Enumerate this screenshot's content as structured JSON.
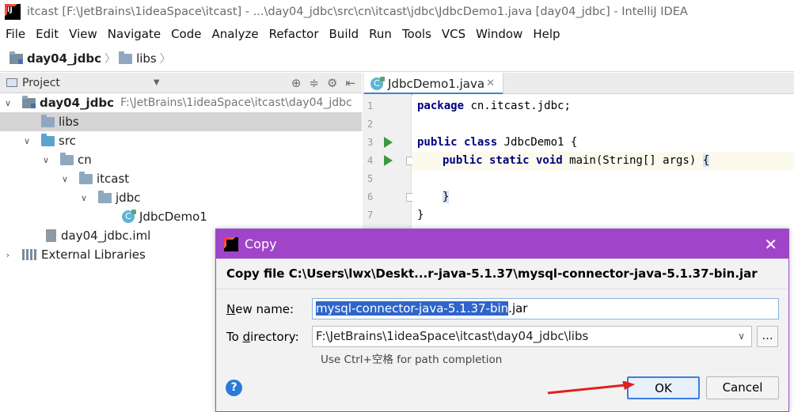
{
  "window": {
    "title": "itcast [F:\\JetBrains\\1ideaSpace\\itcast] - ...\\day04_jdbc\\src\\cn\\itcast\\jdbc\\JdbcDemo1.java [day04_jdbc] - IntelliJ IDEA",
    "logo_text": "IJ"
  },
  "menu": [
    "File",
    "Edit",
    "View",
    "Navigate",
    "Code",
    "Analyze",
    "Refactor",
    "Build",
    "Run",
    "Tools",
    "VCS",
    "Window",
    "Help"
  ],
  "breadcrumb": {
    "project": "day04_jdbc",
    "folder": "libs"
  },
  "project_panel": {
    "title": "Project",
    "tree": [
      {
        "label": "day04_jdbc",
        "path": "F:\\JetBrains\\1ideaSpace\\itcast\\day04_jdbc"
      },
      {
        "label": "libs"
      },
      {
        "label": "src"
      },
      {
        "label": "cn"
      },
      {
        "label": "itcast"
      },
      {
        "label": "jdbc"
      },
      {
        "label": "JdbcDemo1"
      },
      {
        "label": "day04_jdbc.iml"
      },
      {
        "label": "External Libraries"
      }
    ]
  },
  "editor": {
    "tab": "JdbcDemo1.java",
    "line_numbers": [
      "1",
      "2",
      "3",
      "4",
      "5",
      "6",
      "7"
    ],
    "lines": {
      "l1_kw": "package",
      "l1_rest": " cn.itcast.jdbc;",
      "l3_kw": "public class",
      "l3_rest": " JdbcDemo1 {",
      "l4_kw": "public static void",
      "l4_rest": " main(String[] args) ",
      "l4_brace": "{",
      "l6_brace": "}",
      "l7": "}"
    }
  },
  "dialog": {
    "title": "Copy",
    "header": "Copy file C:\\Users\\lwx\\Deskt...r-java-5.1.37\\mysql-connector-java-5.1.37-bin.jar",
    "new_name_label_u": "N",
    "new_name_label_rest": "ew name:",
    "new_name_selected": "mysql-connector-java-5.1.37-bin",
    "new_name_ext": ".jar",
    "dir_label_pre": "To ",
    "dir_label_u": "d",
    "dir_label_rest": "irectory:",
    "dir_value": "F:\\JetBrains\\1ideaSpace\\itcast\\day04_jdbc\\libs",
    "browse": "...",
    "hint": "Use Ctrl+空格 for path completion",
    "help": "?",
    "ok": "OK",
    "cancel": "Cancel"
  },
  "colors": {
    "dialog_title": "#a044c9",
    "selection": "#2f65ca",
    "keyword": "#000080",
    "annotation_arrow": "#e02020"
  }
}
